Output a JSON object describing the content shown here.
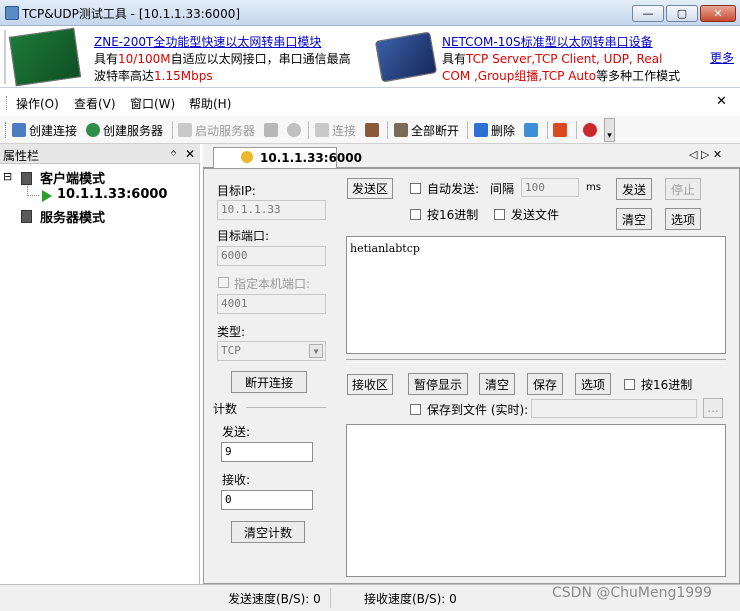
{
  "window": {
    "title": "TCP&UDP测试工具 - [10.1.1.33:6000]",
    "min": "—",
    "max": "▢",
    "close": "✕"
  },
  "banner": {
    "left": {
      "heading": "ZNE-200T全功能型快速以太网转串口模块",
      "line2a": "具有",
      "line2b": "10/100M",
      "line2c": "自适应以太网接口，串口通信最高",
      "line3a": "波特率高达",
      "line3b": "1.15Mbps"
    },
    "right": {
      "heading": "NETCOM-10S标准型以太网转串口设备",
      "line2a": "具有",
      "line2b": "TCP Server,TCP Client, UDP, Real",
      "line3a": "COM ,Group组播,TCP Auto",
      "line3b": "等多种工作模式"
    },
    "more": "更多"
  },
  "menu": {
    "items": [
      "操作(O)",
      "查看(V)",
      "窗口(W)",
      "帮助(H)"
    ],
    "close": "✕"
  },
  "toolbar": {
    "create_conn": "创建连接",
    "create_server": "创建服务器",
    "start_server": "启动服务器",
    "connect": "连接",
    "disconnect_all": "全部断开",
    "delete": "删除"
  },
  "sidebar": {
    "title": "属性栏",
    "pin": "ᛜ",
    "close": "✕",
    "nodes": {
      "client": "客户端模式",
      "conn": "10.1.1.33:6000",
      "server": "服务器模式"
    },
    "expander": "⊟"
  },
  "tab": {
    "label": "10.1.1.33:6000",
    "nav": "◁ ▷ ✕"
  },
  "left_panel": {
    "target_ip_label": "目标IP:",
    "target_ip": "10.1.1.33",
    "target_port_label": "目标端口:",
    "target_port": "6000",
    "local_port_label": "指定本机端口:",
    "local_port": "4001",
    "type_label": "类型:",
    "type": "TCP",
    "disconnect": "断开连接",
    "count_label": "计数",
    "send_label": "发送:",
    "send_count": "9",
    "recv_label": "接收:",
    "recv_count": "0",
    "clear_count": "清空计数"
  },
  "send_area": {
    "label": "发送区",
    "auto_send": "自动发送:",
    "interval_label": "间隔",
    "interval": "100",
    "unit": "ms",
    "send": "发送",
    "stop": "停止",
    "hex": "按16进制",
    "send_file": "发送文件",
    "clear": "清空",
    "options": "选项",
    "content": "hetianlabtcp"
  },
  "recv_area": {
    "label": "接收区",
    "pause": "暂停显示",
    "clear": "清空",
    "save": "保存",
    "options": "选项",
    "hex": "按16进制",
    "save_file": "保存到文件 (实时):",
    "browse": "..."
  },
  "status": {
    "send_speed": "发送速度(B/S): 0",
    "recv_speed": "接收速度(B/S): 0",
    "watermark": "CSDN @ChuMeng1999"
  }
}
